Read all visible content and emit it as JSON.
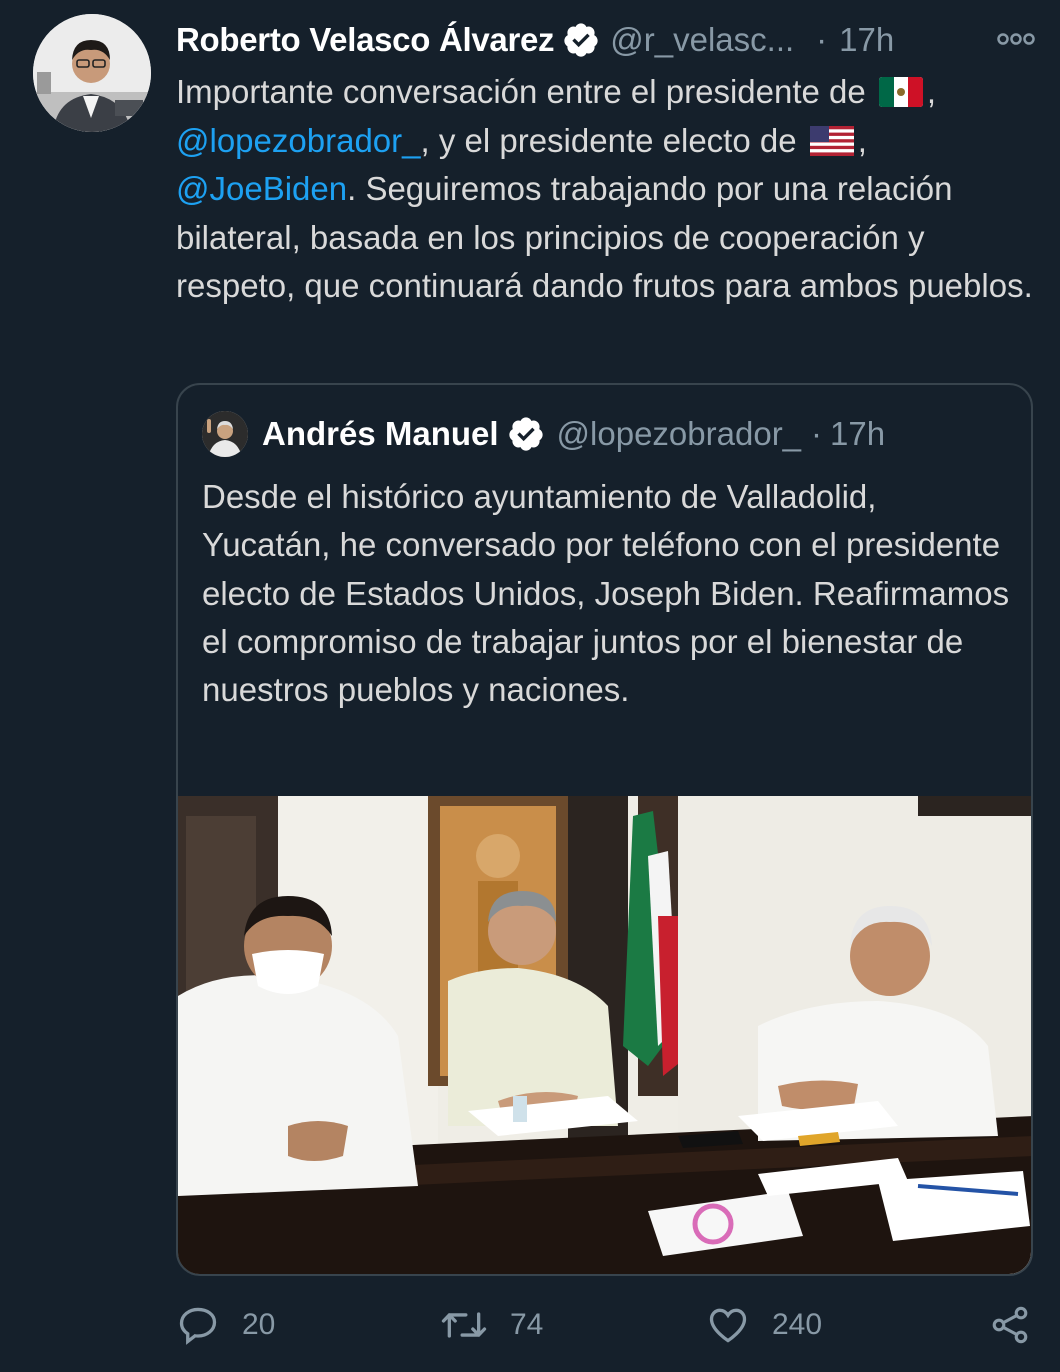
{
  "author": {
    "name": "Roberto Velasco Álvarez",
    "handle": "@r_velasc...",
    "separator": "·",
    "time": "17h"
  },
  "tweet": {
    "text_1": "Importante conversación entre el presidente de",
    "flag_1": "mexico-flag-emoji",
    "text_2": ",",
    "mention_1": "@lopezobrador_",
    "text_3": ", y el presidente electo de",
    "flag_2": "usa-flag-emoji",
    "text_4": ",",
    "mention_2": "@JoeBiden",
    "text_5": ". Seguiremos trabajando por una relación bilateral, basada en los principios de cooperación y respeto, que continuará dando frutos para ambos pueblos."
  },
  "quoted": {
    "name": "Andrés Manuel",
    "handle": "@lopezobrador_",
    "separator": "·",
    "time": "17h",
    "text": "Desde el histórico ayuntamiento de Valladolid, Yucatán, he conversado por teléfono con el presidente electo de Estados Unidos, Joseph Biden. Reafirmamos el compromiso de trabajar juntos por el bienestar de nuestros pueblos y naciones."
  },
  "actions": {
    "replies": "20",
    "retweets": "74",
    "likes": "240"
  },
  "colors": {
    "background": "#15202b",
    "text": "#d9d9d9",
    "muted": "#8899a6",
    "link": "#1da1f2",
    "border": "#38444d"
  }
}
